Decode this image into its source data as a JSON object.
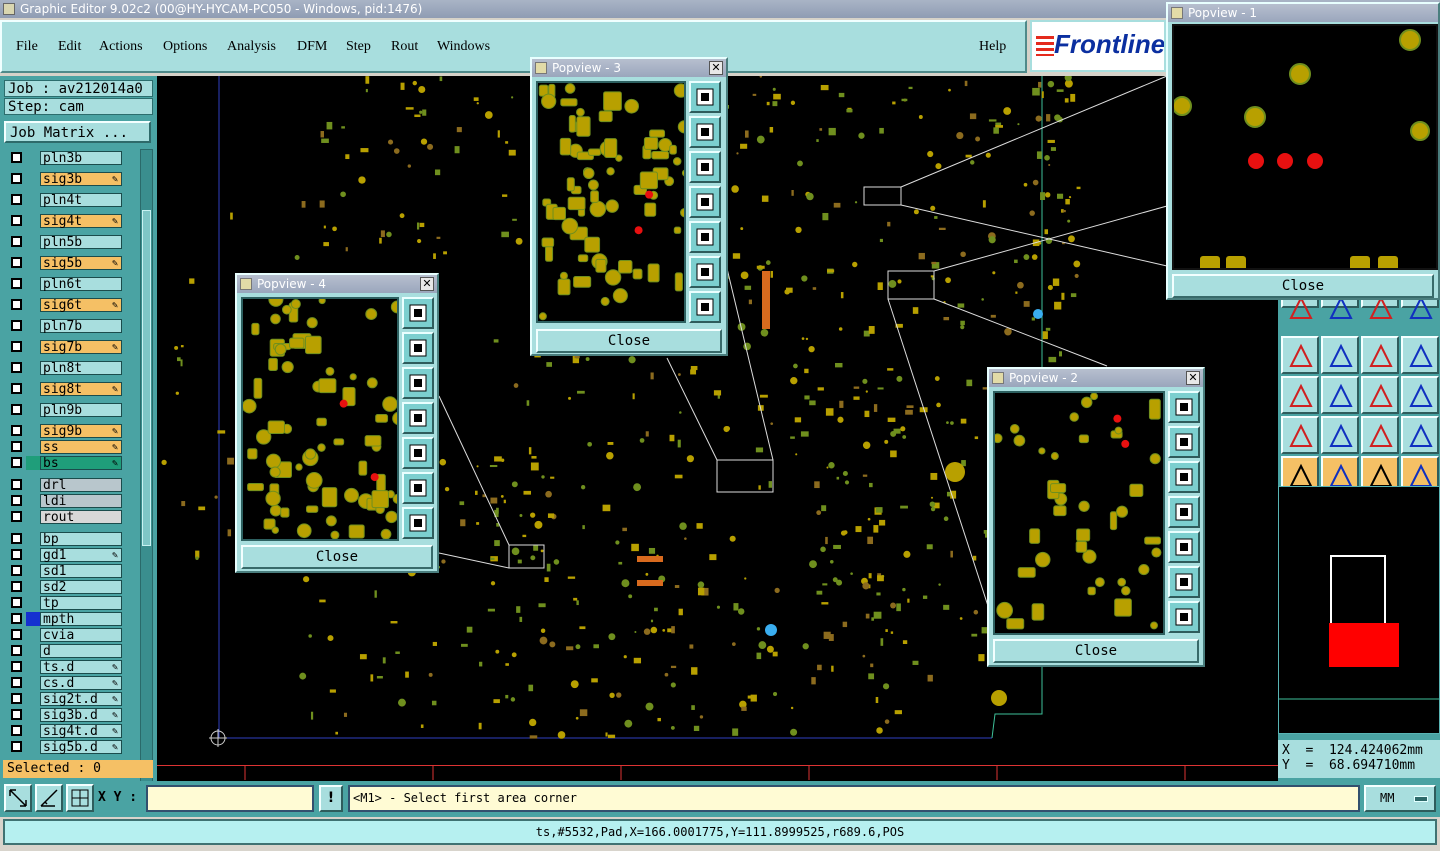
{
  "app": {
    "title": "Graphic Editor 9.02c2 (00@HY-HYCAM-PC050 - Windows, pid:1476)",
    "logo": "Frontline"
  },
  "menu": [
    "File",
    "Edit",
    "Actions",
    "Options",
    "Analysis",
    "DFM",
    "Step",
    "Rout",
    "Windows",
    "Help"
  ],
  "job": {
    "job_label": "Job : av212014a0",
    "step_label": "Step: cam",
    "matrix_button": "Job Matrix ..."
  },
  "layers": [
    {
      "name": "pln3b",
      "color": "#a8dede",
      "swatch": "",
      "edit": false
    },
    {
      "name": "sig3b",
      "color": "#f5c065",
      "swatch": "",
      "edit": true
    },
    {
      "name": "pln4t",
      "color": "#a8dede",
      "swatch": "",
      "edit": false
    },
    {
      "name": "sig4t",
      "color": "#f5c065",
      "swatch": "",
      "edit": true
    },
    {
      "name": "pln5b",
      "color": "#a8dede",
      "swatch": "",
      "edit": false
    },
    {
      "name": "sig5b",
      "color": "#f5c065",
      "swatch": "",
      "edit": true
    },
    {
      "name": "pln6t",
      "color": "#a8dede",
      "swatch": "",
      "edit": false
    },
    {
      "name": "sig6t",
      "color": "#f5c065",
      "swatch": "",
      "edit": true
    },
    {
      "name": "pln7b",
      "color": "#a8dede",
      "swatch": "",
      "edit": false
    },
    {
      "name": "sig7b",
      "color": "#f5c065",
      "swatch": "",
      "edit": true
    },
    {
      "name": "pln8t",
      "color": "#a8dede",
      "swatch": "",
      "edit": false
    },
    {
      "name": "sig8t",
      "color": "#f5c065",
      "swatch": "",
      "edit": true
    },
    {
      "name": "pln9b",
      "color": "#a8dede",
      "swatch": "",
      "edit": false
    },
    {
      "name": "sig9b",
      "color": "#f5c065",
      "swatch": "",
      "edit": true
    },
    {
      "name": "ss",
      "color": "#f5c065",
      "swatch": "",
      "edit": true
    },
    {
      "name": "bs",
      "color": "#1f9e7a",
      "swatch": "#1f9e7a",
      "edit": true
    },
    {
      "name": "drl",
      "color": "#b8c6cc",
      "swatch": "",
      "edit": false
    },
    {
      "name": "ldi",
      "color": "#b8c6cc",
      "swatch": "",
      "edit": false
    },
    {
      "name": "rout",
      "color": "#d8d8d8",
      "swatch": "",
      "edit": false
    },
    {
      "name": "bp",
      "color": "#a8dede",
      "swatch": "",
      "edit": false
    },
    {
      "name": "gd1",
      "color": "#a8dede",
      "swatch": "",
      "edit": true
    },
    {
      "name": "sd1",
      "color": "#a8dede",
      "swatch": "",
      "edit": false
    },
    {
      "name": "sd2",
      "color": "#a8dede",
      "swatch": "",
      "edit": false
    },
    {
      "name": "tp",
      "color": "#a8dede",
      "swatch": "",
      "edit": false
    },
    {
      "name": "mpth",
      "color": "#a8dede",
      "swatch": "#1530d0",
      "edit": false
    },
    {
      "name": "cvia",
      "color": "#a8dede",
      "swatch": "",
      "edit": false
    },
    {
      "name": "d",
      "color": "#a8dede",
      "swatch": "",
      "edit": false
    },
    {
      "name": "ts.d",
      "color": "#a8dede",
      "swatch": "",
      "edit": true
    },
    {
      "name": "cs.d",
      "color": "#a8dede",
      "swatch": "",
      "edit": true
    },
    {
      "name": "sig2t.d",
      "color": "#a8dede",
      "swatch": "",
      "edit": true
    },
    {
      "name": "sig3b.d",
      "color": "#a8dede",
      "swatch": "",
      "edit": true
    },
    {
      "name": "sig4t.d",
      "color": "#a8dede",
      "swatch": "",
      "edit": true
    },
    {
      "name": "sig5b.d",
      "color": "#a8dede",
      "swatch": "",
      "edit": true
    }
  ],
  "selected": "Selected : 0",
  "popups": [
    {
      "title": "Popview - 1",
      "close": "Close"
    },
    {
      "title": "Popview - 2",
      "close": "Close"
    },
    {
      "title": "Popview - 3",
      "close": "Close"
    },
    {
      "title": "Popview - 4",
      "close": "Close"
    }
  ],
  "coords": {
    "x": "X  =  124.424062mm",
    "y": "Y  =  68.694710mm"
  },
  "bottom": {
    "xy_label": "X Y :",
    "xy_value": "",
    "excl": "!",
    "prompt": "<M1> - Select first area corner",
    "units": "MM"
  },
  "status": "ts,#5532,Pad,X=166.0001775,Y=111.8999525,r689.6,POS",
  "colors": {
    "pad": "#b8a000",
    "pad_edge": "#6f8f1e",
    "highlight": "#e81010",
    "cyan": "#3aaef0"
  }
}
